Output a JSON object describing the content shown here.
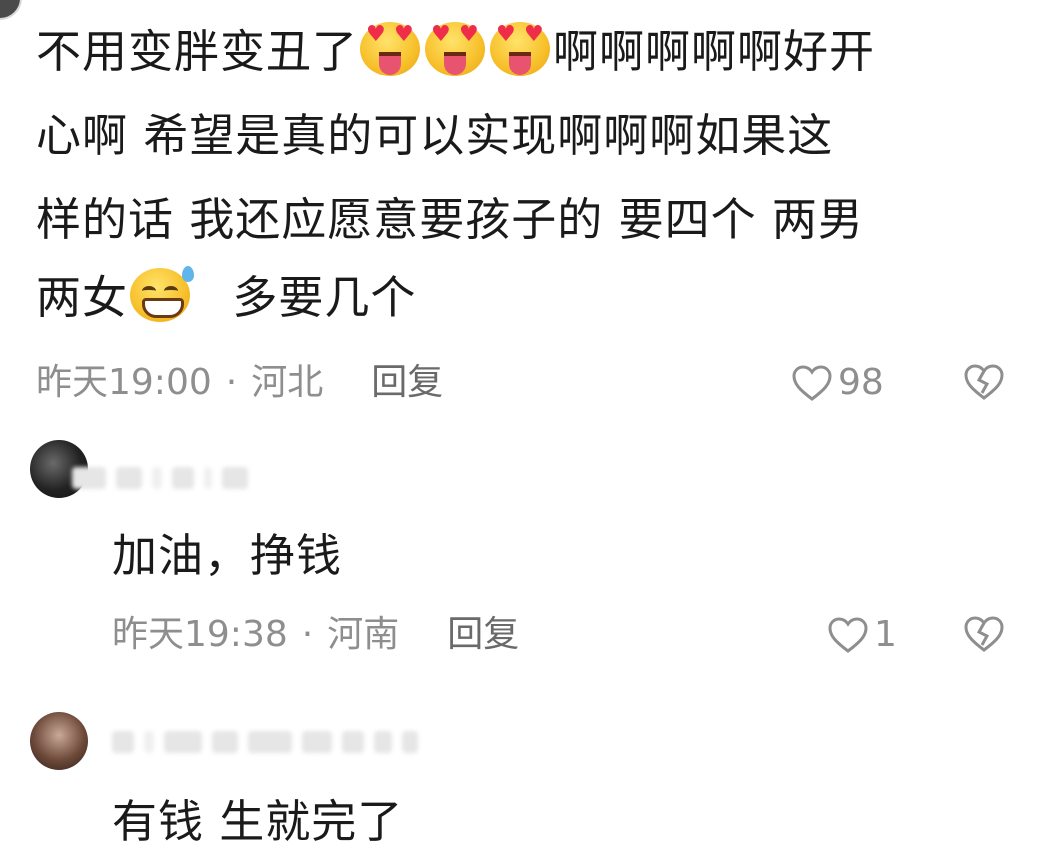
{
  "comment_main": {
    "lines": [
      [
        "不用变胖变丑了",
        "啊啊啊啊啊好开"
      ],
      [
        "心啊 希望是真的可以实现啊啊啊如果这"
      ],
      [
        "样的话 我还应愿意要孩子的 要四个 两男"
      ],
      [
        "两女",
        "多要几个"
      ]
    ],
    "time": "昨天19:00",
    "location": "河北",
    "reply_label": "回复",
    "likes": "98",
    "emoji_heart_eyes": "heart-eyes-tongue-emoji",
    "emoji_grin": "grinning-sweat-emoji"
  },
  "reply_1": {
    "text": "加油，挣钱",
    "time": "昨天19:38",
    "location": "河南",
    "reply_label": "回复",
    "likes": "1"
  },
  "reply_2": {
    "text": "有钱 生就完了"
  },
  "separator": "·",
  "colors": {
    "meta": "#8e8e8e",
    "text": "#1a1a1a",
    "heart": "#8e8e8e"
  }
}
